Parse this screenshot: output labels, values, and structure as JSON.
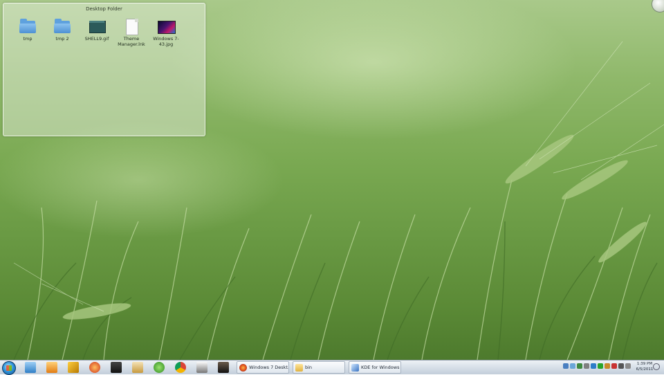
{
  "desktop_folder": {
    "title": "Desktop Folder",
    "items": [
      {
        "label": "tmp",
        "icon": "folder-icon"
      },
      {
        "label": "tmp 2",
        "icon": "folder-icon"
      },
      {
        "label": "SHELL9.gif",
        "icon": "gif-file-icon"
      },
      {
        "label": "Theme Manager.lnk",
        "icon": "shortcut-file-icon"
      },
      {
        "label": "Windows 7-43.jpg",
        "icon": "image-file-icon"
      }
    ]
  },
  "taskbar": {
    "start_icon": "windows-start-orb",
    "quick_launch": [
      "explorer-icon",
      "media-player-icon",
      "winamp-icon",
      "ccleaner-icon",
      "shield-icon",
      "word-icon",
      "utorrent-icon",
      "chrome-icon",
      "calculator-icon",
      "terminal-icon"
    ],
    "tasks": [
      {
        "label": "Windows 7 Deskt...",
        "icon": "firefox-icon"
      },
      {
        "label": "bin",
        "icon": "folder-icon"
      },
      {
        "label": "KDE for Windows ...",
        "icon": "pen-icon"
      }
    ],
    "clock_time": "1:39 PM",
    "clock_date": "6/5/2011"
  },
  "colors": {
    "folder_blue": "#5ea1de",
    "taskbar_top": "#eef2f6",
    "taskbar_bottom": "#c3ceda",
    "grass_green": "#6a9a44"
  }
}
